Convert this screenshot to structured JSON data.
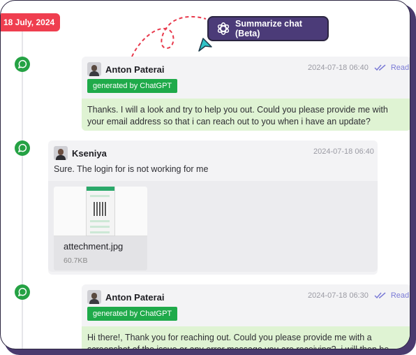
{
  "date_badge": "18 July, 2024",
  "summarize_button": {
    "label": "Summarize chat (Beta)",
    "icon": "openai-logo-icon"
  },
  "colors": {
    "accent_purple": "#4b3b78",
    "date_red": "#ef3e4f",
    "gpt_green": "#1faa4a",
    "bubble_green": "#dff3d3",
    "read_blue": "#7b7bd6",
    "whatsapp_green": "#25a244"
  },
  "messages": [
    {
      "channel_icon": "whatsapp-icon",
      "sender": "Anton Paterai",
      "timestamp": "2024-07-18 06:40",
      "status": "Read",
      "badge": "generated by ChatGPT",
      "text": "Thanks. I will a look and try to help you out. Could you please provide me with your email address so that i can reach out to you when i have an update?"
    },
    {
      "channel_icon": "whatsapp-icon",
      "sender": "Kseniya",
      "timestamp": "2024-07-18 06:40",
      "text": "Sure. The login for is not working for me",
      "attachment": {
        "name": "attechment.jpg",
        "size": "60.7KB"
      }
    },
    {
      "channel_icon": "whatsapp-icon",
      "sender": "Anton Paterai",
      "timestamp": "2024-07-18 06:30",
      "status": "Read",
      "badge": "generated by ChatGPT",
      "text": "Hi there!, Thank you for reaching out. Could you please provide me with a screenshot of the issue or any error message you are receiving?, i will then be able to better assist"
    }
  ]
}
